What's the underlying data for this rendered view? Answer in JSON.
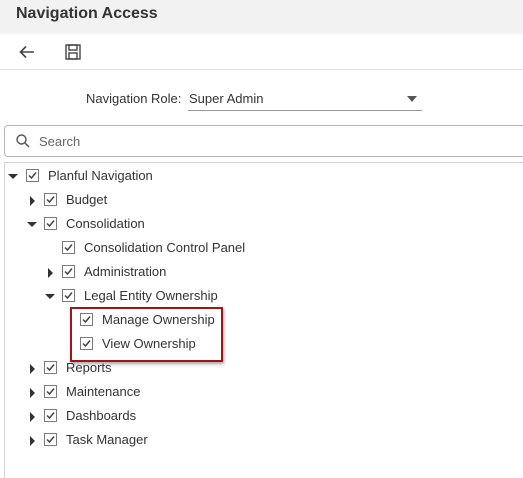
{
  "header": {
    "title": "Navigation Access"
  },
  "toolbar": {
    "back_icon": "back-arrow-icon",
    "save_icon": "save-icon"
  },
  "role": {
    "label": "Navigation Role:",
    "value": "Super Admin"
  },
  "search": {
    "placeholder": "Search",
    "value": ""
  },
  "tree": {
    "root": "Planful Navigation",
    "budget": "Budget",
    "consolidation": "Consolidation",
    "ccp": "Consolidation Control Panel",
    "administration": "Administration",
    "leo": "Legal Entity Ownership",
    "manage": "Manage Ownership",
    "view": "View Ownership",
    "reports": "Reports",
    "maintenance": "Maintenance",
    "dashboards": "Dashboards",
    "task_manager": "Task Manager"
  },
  "colors": {
    "highlight": "#a31515",
    "header_bg": "#f2f2f2"
  }
}
